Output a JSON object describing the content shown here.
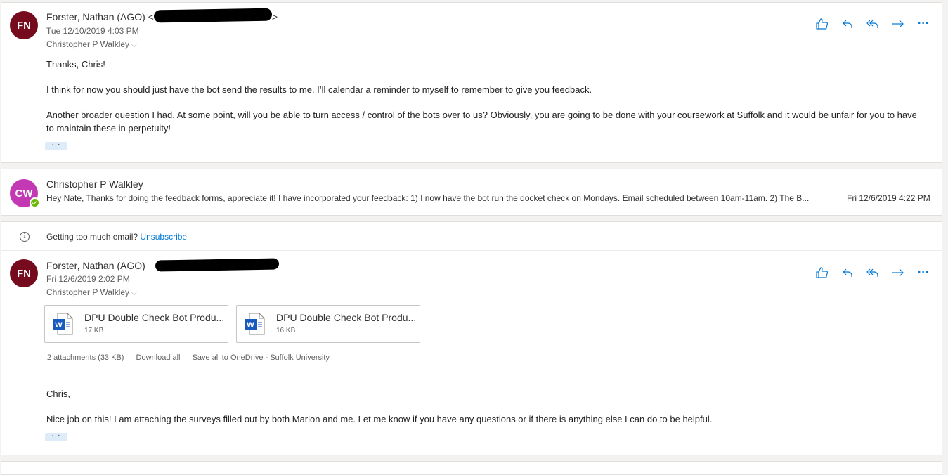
{
  "message1": {
    "avatar_initials": "FN",
    "avatar_color": "#750b1c",
    "sender_name": "Forster, Nathan (AGO) <",
    "sender_close": ">",
    "date": "Tue 12/10/2019 4:03 PM",
    "to": "Christopher P Walkley",
    "body": [
      "Thanks, Chris!",
      "I think for now you should just have the bot send the results to me.  I’ll calendar a reminder to myself to remember to give you feedback.",
      "Another broader question I had.  At some point, will you be able to turn access / control of the bots over to us?  Obviously, you are going to be done with your coursework at Suffolk and it would be unfair for you to have to maintain these in perpetuity!"
    ],
    "more": "···"
  },
  "message2": {
    "avatar_initials": "CW",
    "avatar_color": "#c239b3",
    "sender_name": "Christopher P Walkley",
    "preview": "Hey Nate, Thanks for doing the feedback forms, appreciate it! I have incorporated your feedback: 1) I now have the bot run the docket check on Mondays. Email scheduled between 10am-11am. 2) The B...",
    "date": "Fri 12/6/2019 4:22 PM"
  },
  "notice": {
    "icon": "i",
    "text": "Getting too much email? ",
    "link": "Unsubscribe"
  },
  "message3": {
    "avatar_initials": "FN",
    "avatar_color": "#750b1c",
    "sender_name": "Forster, Nathan (AGO)",
    "date": "Fri 12/6/2019 2:02 PM",
    "to": "Christopher P Walkley",
    "attachments": [
      {
        "name": "DPU Double Check Bot Produ...",
        "size": "17 KB"
      },
      {
        "name": "DPU Double Check Bot Produ...",
        "size": "16 KB"
      }
    ],
    "attach_summary": "2 attachments (33 KB)",
    "download_all": "Download all",
    "save_onedrive": "Save all to OneDrive - Suffolk University",
    "body": [
      "Chris,",
      "Nice job on this!  I am attaching the surveys filled out by both Marlon and me.  Let me know if you have any questions or if there is anything else I can do to be helpful."
    ],
    "more": "···"
  },
  "actions": {
    "like": "like-icon",
    "reply": "reply-icon",
    "reply_all": "reply-all-icon",
    "forward": "forward-icon",
    "more": "···"
  },
  "colors": {
    "accent": "#0078d4",
    "presence": "#6bb700"
  }
}
